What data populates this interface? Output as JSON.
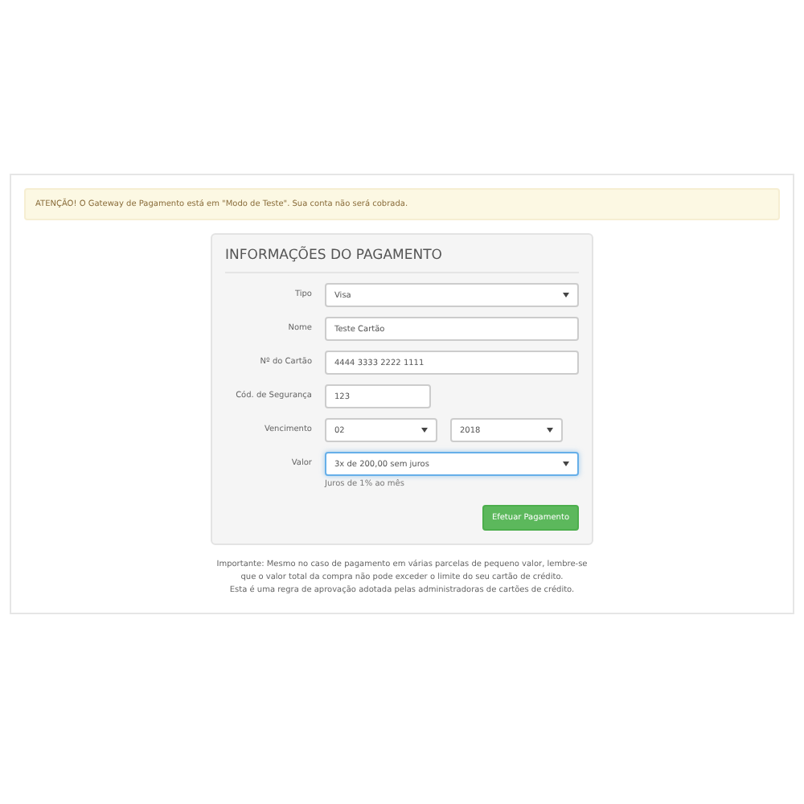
{
  "alert": {
    "text": "ATENÇÃO! O Gateway de Pagamento está em \"Modo de Teste\". Sua conta não será cobrada."
  },
  "form": {
    "title": "INFORMAÇÕES DO PAGAMENTO",
    "rows": [
      {
        "label": "Tipo",
        "fields": [
          {
            "kind": "select",
            "value": "Visa",
            "focused": false
          }
        ]
      },
      {
        "label": "Nome",
        "fields": [
          {
            "kind": "input",
            "value": "Teste Cartão",
            "focused": false
          }
        ]
      },
      {
        "label": "Nº do Cartão",
        "fields": [
          {
            "kind": "input",
            "value": "4444 3333 2222 1111",
            "focused": false
          }
        ]
      },
      {
        "label": "Cód. de Segurança",
        "fields": [
          {
            "kind": "short_input",
            "value": "123",
            "focused": false
          }
        ]
      },
      {
        "label": "Vencimento",
        "fields": [
          {
            "kind": "select",
            "value": "02",
            "focused": false
          },
          {
            "kind": "select",
            "value": "2018",
            "focused": false
          }
        ]
      },
      {
        "label": "Valor",
        "fields": [
          {
            "kind": "select",
            "value": "3x de 200,00 sem juros",
            "focused": true
          }
        ],
        "help": "Juros de 1% ao mês"
      }
    ],
    "submit": "Efetuar Pagamento"
  },
  "notes": [
    "Importante: Mesmo no caso de pagamento em várias parcelas de pequeno valor, lembre-se que o valor total da compra não pode exceder o limite do seu cartão de crédito.",
    "Esta é uma regra de aprovação adotada pelas administradoras de cartões de crédito."
  ]
}
